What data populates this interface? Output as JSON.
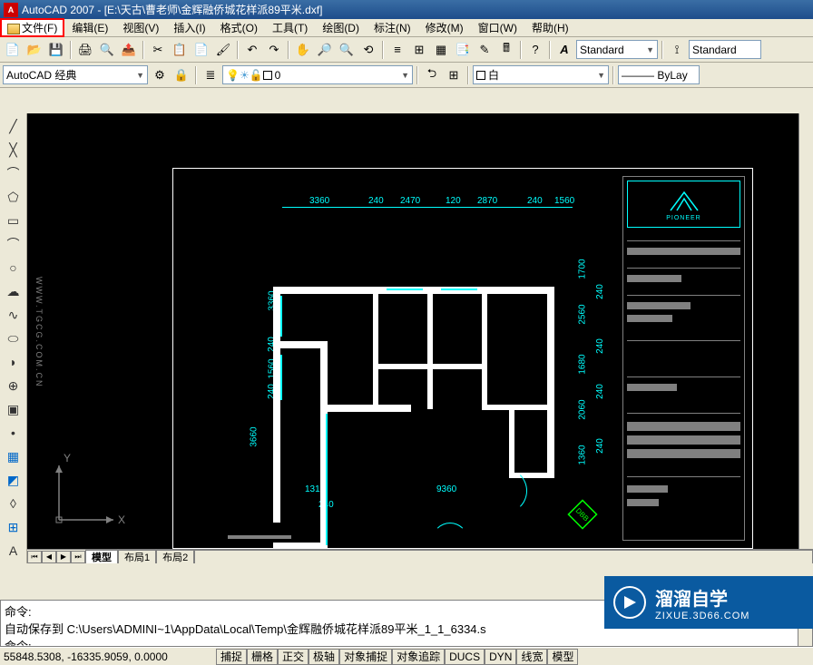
{
  "title": "AutoCAD 2007 - [E:\\天古\\曹老师\\金辉融侨城花样派89平米.dxf]",
  "menu": {
    "file": "文件(F)",
    "edit": "编辑(E)",
    "view": "视图(V)",
    "insert": "插入(I)",
    "format": "格式(O)",
    "tools": "工具(T)",
    "draw": "绘图(D)",
    "dimension": "标注(N)",
    "modify": "修改(M)",
    "window": "窗口(W)",
    "help": "帮助(H)"
  },
  "workspace_combo": "AutoCAD 经典",
  "layer_combo": "0",
  "color_combo": "白",
  "bylayer": "ByLay",
  "style1": "Standard",
  "style2": "Standard",
  "tabs": {
    "model": "模型",
    "layout1": "布局1",
    "layout2": "布局2"
  },
  "ucs": {
    "x": "X",
    "y": "Y"
  },
  "dimensions": {
    "top": [
      "3360",
      "240",
      "2470",
      "120",
      "2870",
      "240",
      "1560"
    ],
    "left_outer": "3660",
    "left_inner": [
      "3360",
      "240",
      "1560",
      "240"
    ],
    "right_outer": [
      "240",
      "240",
      "240",
      "240"
    ],
    "right_inner": [
      "1700",
      "2560",
      "1680",
      "2060",
      "1360"
    ],
    "bottom_inner": [
      "1310",
      "9360"
    ],
    "bottom_outer": "240"
  },
  "title_block": {
    "logo_text": "PIONEER"
  },
  "vtext": "WWW.TGCG.COM.CN",
  "north": "DBB",
  "command": {
    "line1": "命令:",
    "line2": "自动保存到  C:\\Users\\ADMINI~1\\AppData\\Local\\Temp\\金辉融侨城花样派89平米_1_1_6334.s",
    "line3": "命令:"
  },
  "status": {
    "coords": "55848.5308, -16335.9059, 0.0000",
    "snap": "捕捉",
    "grid": "栅格",
    "ortho": "正交",
    "polar": "极轴",
    "osnap": "对象捕捉",
    "otrack": "对象追踪",
    "ducs": "DUCS",
    "dyn": "DYN",
    "lwt": "线宽",
    "model": "模型"
  },
  "watermark": {
    "main": "溜溜自学",
    "sub": "ZIXUE.3D66.COM"
  }
}
